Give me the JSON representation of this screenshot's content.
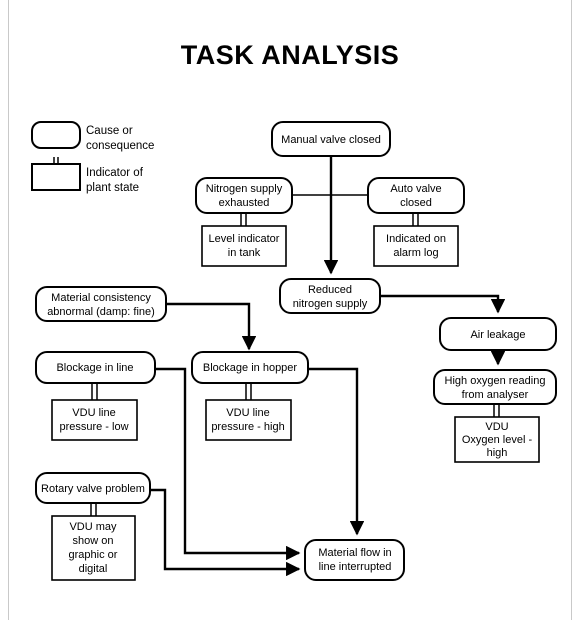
{
  "title": "TASK ANALYSIS",
  "colors": {
    "background": "#ffffff",
    "stroke": "#000000",
    "frame": "#c9c9c9"
  },
  "legend": {
    "items": [
      {
        "shape": "rounded-rect",
        "label_line1": "Cause or",
        "label_line2": "consequence"
      },
      {
        "shape": "square-rect-with-stub",
        "label_line1": "Indicator of",
        "label_line2": "plant state"
      }
    ]
  },
  "chart_data": {
    "type": "diagram",
    "title": "TASK ANALYSIS",
    "nodes": [
      {
        "id": "manual_valve",
        "kind": "cause",
        "lines": [
          "Manual valve closed"
        ]
      },
      {
        "id": "nitrogen_exhausted",
        "kind": "cause",
        "lines": [
          "Nitrogen supply",
          "exhausted"
        ]
      },
      {
        "id": "auto_valve",
        "kind": "cause",
        "lines": [
          "Auto valve",
          "closed"
        ]
      },
      {
        "id": "level_indicator",
        "kind": "indicator",
        "lines": [
          "Level indicator",
          "in tank"
        ]
      },
      {
        "id": "alarm_log",
        "kind": "indicator",
        "lines": [
          "Indicated on",
          "alarm log"
        ]
      },
      {
        "id": "reduced_nitrogen",
        "kind": "cause",
        "lines": [
          "Reduced",
          "nitrogen supply"
        ]
      },
      {
        "id": "air_leakage",
        "kind": "cause",
        "lines": [
          "Air leakage"
        ]
      },
      {
        "id": "high_oxygen",
        "kind": "cause",
        "lines": [
          "High oxygen reading",
          "from analyser"
        ]
      },
      {
        "id": "vdu_oxygen",
        "kind": "indicator",
        "lines": [
          "VDU",
          "Oxygen level -",
          "high"
        ]
      },
      {
        "id": "material_consistency",
        "kind": "cause",
        "lines": [
          "Material consistency",
          "abnormal (damp: fine)"
        ]
      },
      {
        "id": "blockage_line",
        "kind": "cause",
        "lines": [
          "Blockage in line"
        ]
      },
      {
        "id": "blockage_hopper",
        "kind": "cause",
        "lines": [
          "Blockage in hopper"
        ]
      },
      {
        "id": "vdu_line_low",
        "kind": "indicator",
        "lines": [
          "VDU line",
          "pressure - low"
        ]
      },
      {
        "id": "vdu_line_high",
        "kind": "indicator",
        "lines": [
          "VDU line",
          "pressure - high"
        ]
      },
      {
        "id": "rotary_valve",
        "kind": "cause",
        "lines": [
          "Rotary valve problem"
        ]
      },
      {
        "id": "vdu_may_show",
        "kind": "indicator",
        "lines": [
          "VDU may",
          "show on",
          "graphic or",
          "digital"
        ]
      },
      {
        "id": "material_flow",
        "kind": "cause",
        "lines": [
          "Material flow in",
          "line interrupted"
        ]
      }
    ],
    "edges": [
      {
        "from": "manual_valve",
        "to": "reduced_nitrogen",
        "arrow": true
      },
      {
        "from": "nitrogen_exhausted",
        "to": "manual_valve",
        "arrow": false
      },
      {
        "from": "auto_valve",
        "to": "manual_valve",
        "arrow": false
      },
      {
        "from": "nitrogen_exhausted",
        "to": "level_indicator",
        "arrow": false,
        "style": "indicator-link"
      },
      {
        "from": "auto_valve",
        "to": "alarm_log",
        "arrow": false,
        "style": "indicator-link"
      },
      {
        "from": "reduced_nitrogen",
        "to": "air_leakage",
        "arrow": true
      },
      {
        "from": "air_leakage",
        "to": "high_oxygen",
        "arrow": true
      },
      {
        "from": "high_oxygen",
        "to": "vdu_oxygen",
        "arrow": false,
        "style": "indicator-link"
      },
      {
        "from": "material_consistency",
        "to": "blockage_hopper",
        "arrow": true
      },
      {
        "from": "blockage_line",
        "to": "vdu_line_low",
        "arrow": false,
        "style": "indicator-link"
      },
      {
        "from": "blockage_hopper",
        "to": "vdu_line_high",
        "arrow": false,
        "style": "indicator-link"
      },
      {
        "from": "blockage_hopper",
        "to": "material_flow",
        "arrow": true
      },
      {
        "from": "blockage_line",
        "to": "material_flow",
        "arrow": true
      },
      {
        "from": "rotary_valve",
        "to": "material_flow",
        "arrow": true
      },
      {
        "from": "rotary_valve",
        "to": "vdu_may_show",
        "arrow": false,
        "style": "indicator-link"
      }
    ]
  },
  "nodes": {
    "manual_valve": {
      "line1": "Manual valve closed"
    },
    "nitrogen_exhausted": {
      "line1": "Nitrogen supply",
      "line2": "exhausted"
    },
    "auto_valve": {
      "line1": "Auto valve",
      "line2": "closed"
    },
    "level_indicator": {
      "line1": "Level indicator",
      "line2": "in tank"
    },
    "alarm_log": {
      "line1": "Indicated on",
      "line2": "alarm log"
    },
    "reduced_nitrogen": {
      "line1": "Reduced",
      "line2": "nitrogen supply"
    },
    "air_leakage": {
      "line1": "Air leakage"
    },
    "high_oxygen": {
      "line1": "High oxygen reading",
      "line2": "from analyser"
    },
    "vdu_oxygen": {
      "line1": "VDU",
      "line2": "Oxygen level -",
      "line3": "high"
    },
    "material_consistency": {
      "line1": "Material consistency",
      "line2": "abnormal (damp: fine)"
    },
    "blockage_line": {
      "line1": "Blockage in line"
    },
    "blockage_hopper": {
      "line1": "Blockage in hopper"
    },
    "vdu_line_low": {
      "line1": "VDU line",
      "line2": "pressure - low"
    },
    "vdu_line_high": {
      "line1": "VDU line",
      "line2": "pressure - high"
    },
    "rotary_valve": {
      "line1": "Rotary valve problem"
    },
    "vdu_may_show": {
      "line1": "VDU may",
      "line2": "show on",
      "line3": "graphic or",
      "line4": "digital"
    },
    "material_flow": {
      "line1": "Material flow in",
      "line2": "line interrupted"
    }
  }
}
